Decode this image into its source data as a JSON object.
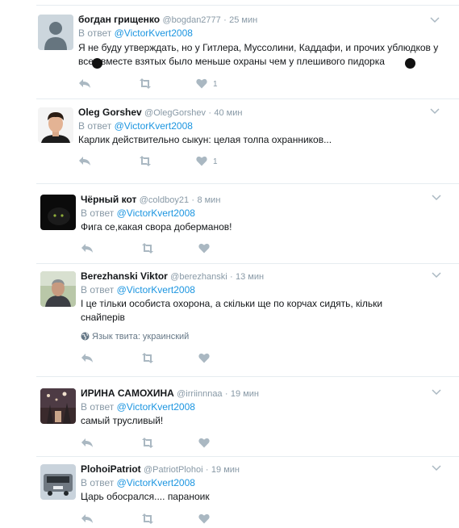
{
  "reply_prefix": "В ответ",
  "tweets": [
    {
      "name": "богдан грищенко",
      "handle": "@bogdan2777",
      "time": "25 мин",
      "mention": "@VictorKvert2008",
      "text": "Я не буду утверждать, но у Гитлера, Муссолини, Каддафи, и прочих ублюдков у всех вместе взятых было меньше охраны чем у плешивого пидорка",
      "likes": "1"
    },
    {
      "name": "Oleg Gorshev",
      "handle": "@OlegGorshev",
      "time": "40 мин",
      "mention": "@VictorKvert2008",
      "text": "Карлик действительно сыкун: целая толпа охранников...",
      "likes": "1"
    },
    {
      "name": "Чёрный кот",
      "handle": "@coldboy21",
      "time": "8 мин",
      "mention": "@VictorKvert2008",
      "text": "Фига се,какая свора доберманов!",
      "likes": ""
    },
    {
      "name": "Berezhanski Viktor",
      "handle": "@berezhanski",
      "time": "13 мин",
      "mention": "@VictorKvert2008",
      "text": "І це тільки особиста охорона, а скільки ще по корчах сидять, кільки снайперів",
      "lang": "Язык твита: украинский",
      "likes": ""
    },
    {
      "name": "ИРИНА САМОХИНА",
      "handle": "@irriinnnaa",
      "time": "19 мин",
      "mention": "@VictorKvert2008",
      "text": "самый трусливый!",
      "likes": ""
    },
    {
      "name": "PlohoiPatriot",
      "handle": "@PatriotPlohoi",
      "time": "19 мин",
      "mention": "@VictorKvert2008",
      "text": "Царь обосрался.... параноик",
      "likes": ""
    }
  ],
  "colors": {
    "link": "#1b95e0",
    "muted": "#8899a6",
    "icon": "#aab8c2"
  },
  "icons": [
    "reply-icon",
    "retweet-icon",
    "like-icon",
    "chevron-down-icon",
    "globe-icon"
  ]
}
